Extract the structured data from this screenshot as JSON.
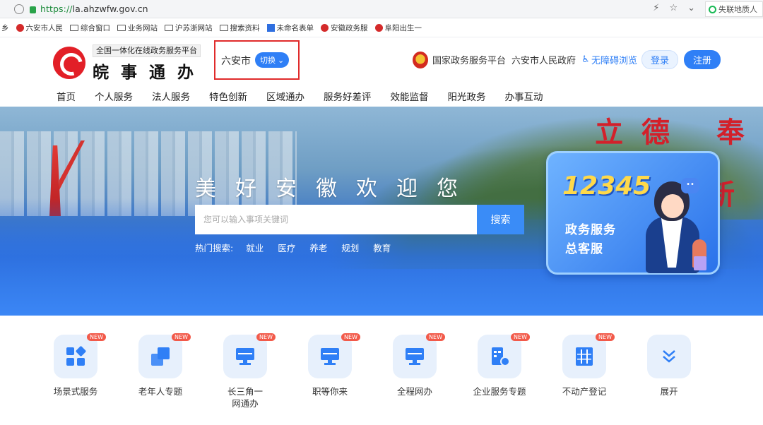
{
  "browser": {
    "url_scheme": "https://",
    "url_host": "la.ahzwfw.gov.cn",
    "side_search_text": "失联地质人",
    "bookmarks": [
      "乡",
      "六安市人民",
      "综合窗口",
      "业务网站",
      "沪苏浙网站",
      "搜索资料",
      "未命名表单",
      "安徽政务服",
      "阜阳出生一"
    ]
  },
  "header": {
    "logo_tag": "全国一体化在线政务服务平台",
    "logo_name": "皖事通办",
    "city": "六安市",
    "switch_label": "切换",
    "links": [
      "国家政务服务平台",
      "六安市人民政府"
    ],
    "accessibility": "无障碍浏览",
    "login": "登录",
    "register": "注册"
  },
  "nav": [
    "首页",
    "个人服务",
    "法人服务",
    "特色创新",
    "区域通办",
    "服务好差评",
    "效能监督",
    "阳光政务",
    "办事互动"
  ],
  "banner": {
    "slogan": "美好安徽欢迎您",
    "search_placeholder": "您可以输入事项关键词",
    "search_button": "搜索",
    "hot_label": "热门搜索:",
    "hot_keywords": [
      "就业",
      "医疗",
      "养老",
      "规划",
      "教育"
    ],
    "calligraphy_top": "立德 奉",
    "calligraphy_side": "新",
    "card": {
      "number": "12345",
      "line1": "政务服务",
      "line2": "总客服"
    }
  },
  "services": [
    {
      "label": "场景式服务",
      "new": "NEW",
      "icon": "scene-icon"
    },
    {
      "label": "老年人专题",
      "new": "NEW",
      "icon": "elderly-icon"
    },
    {
      "label": "长三角一网通办",
      "new": "NEW",
      "icon": "yrd-icon"
    },
    {
      "label": "职等你来",
      "new": "NEW",
      "icon": "jobs-icon"
    },
    {
      "label": "全程网办",
      "new": "NEW",
      "icon": "online-icon"
    },
    {
      "label": "企业服务专题",
      "new": "NEW",
      "icon": "enterprise-icon"
    },
    {
      "label": "不动产登记",
      "new": "NEW",
      "icon": "realestate-icon"
    },
    {
      "label": "展开",
      "new": "",
      "icon": "expand-icon"
    }
  ],
  "colors": {
    "primary": "#2f7ff6",
    "logo_red": "#e21f27",
    "highlight_border": "#e02b2b"
  }
}
